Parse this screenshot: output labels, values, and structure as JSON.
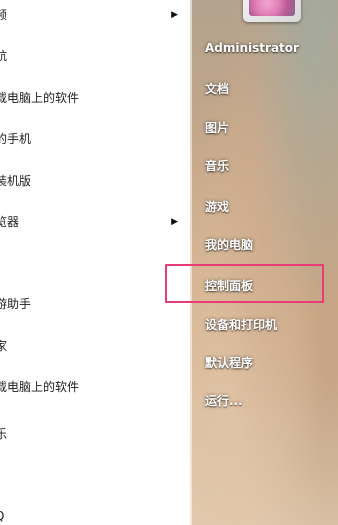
{
  "programs": [
    {
      "label": "频",
      "has_arrow": true
    },
    {
      "label": "航",
      "has_arrow": false
    },
    {
      "label": "载电脑上的软件",
      "has_arrow": false
    },
    {
      "label": "的手机",
      "has_arrow": false
    },
    {
      "label": "装机版",
      "has_arrow": false
    },
    {
      "label": "览器",
      "has_arrow": true
    },
    {
      "label": "",
      "has_arrow": false
    },
    {
      "label": "游助手",
      "has_arrow": false
    },
    {
      "label": "家",
      "has_arrow": false
    },
    {
      "label": "载电脑上的软件",
      "has_arrow": false
    },
    {
      "label": "乐",
      "has_arrow": false
    },
    {
      "label": "Q",
      "has_arrow": false
    }
  ],
  "arrow_glyph": "▶",
  "user": {
    "name": "Administrator"
  },
  "places": [
    {
      "label": "文档"
    },
    {
      "label": "图片"
    },
    {
      "label": "音乐"
    },
    {
      "label": "游戏"
    },
    {
      "label": "我的电脑"
    },
    {
      "label": "控制面板"
    },
    {
      "label": "设备和打印机"
    },
    {
      "label": "默认程序"
    },
    {
      "label": "运行..."
    }
  ],
  "highlight_color": "#e83c78"
}
